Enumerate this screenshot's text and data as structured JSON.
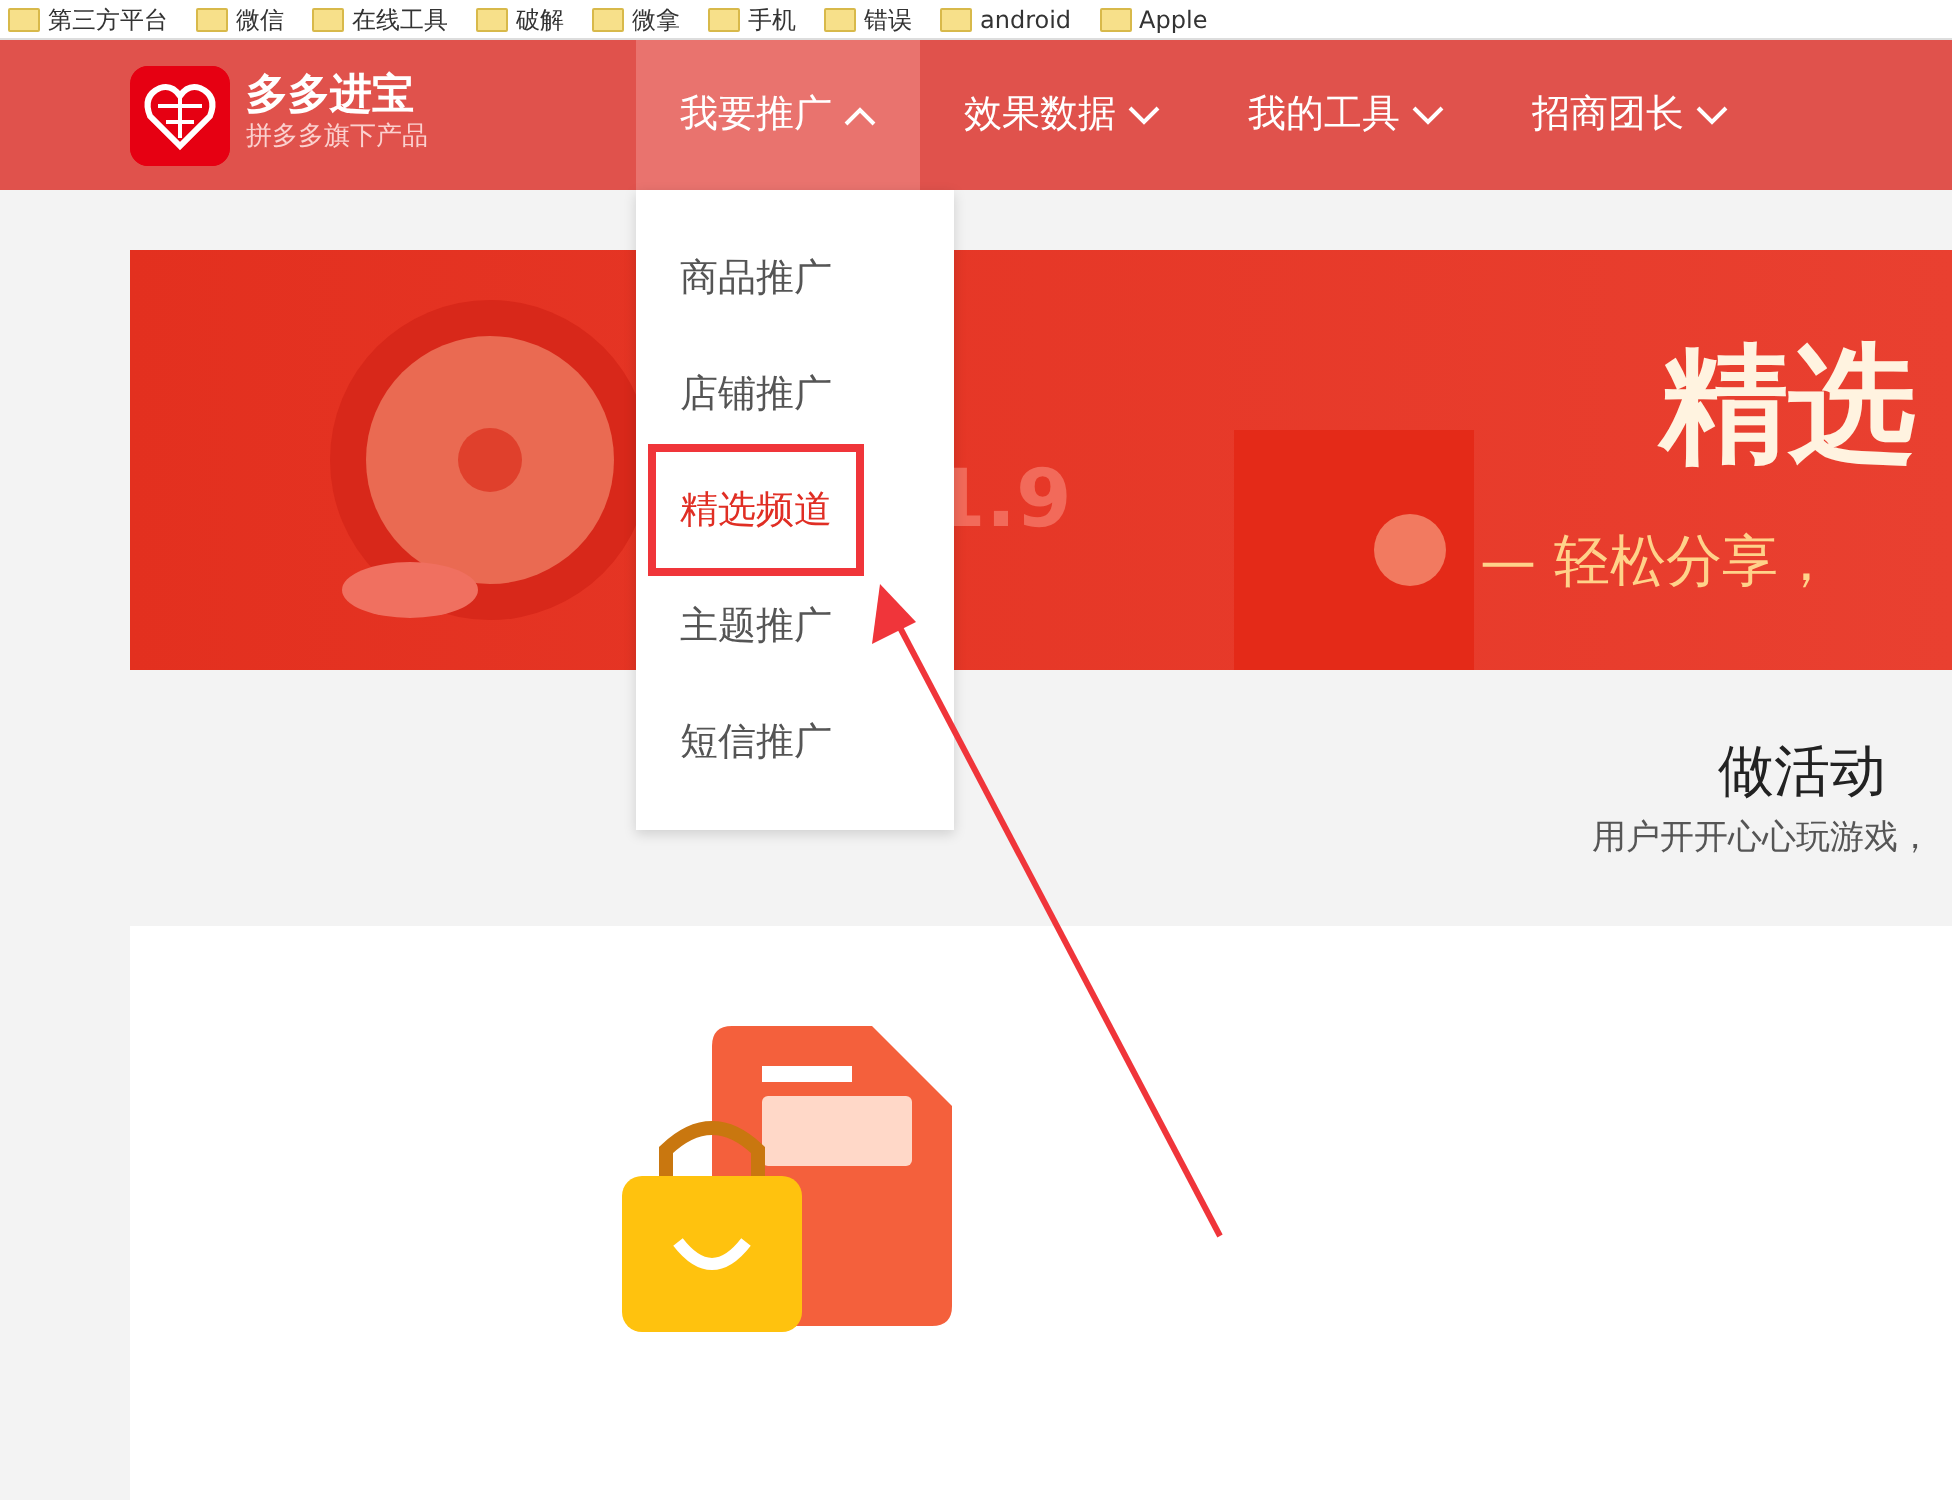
{
  "bookmarks": [
    "第三方平台",
    "微信",
    "在线工具",
    "破解",
    "微拿",
    "手机",
    "错误",
    "android",
    "Apple"
  ],
  "logo": {
    "title": "多多进宝",
    "subtitle": "拼多多旗下产品"
  },
  "nav": [
    {
      "label": "我要推广",
      "expanded": true
    },
    {
      "label": "效果数据",
      "expanded": false
    },
    {
      "label": "我的工具",
      "expanded": false
    },
    {
      "label": "招商团长",
      "expanded": false
    }
  ],
  "dropdown": [
    {
      "label": "商品推广",
      "selected": false
    },
    {
      "label": "店铺推广",
      "selected": false
    },
    {
      "label": "精选频道",
      "selected": true
    },
    {
      "label": "主题推广",
      "selected": false
    },
    {
      "label": "短信推广",
      "selected": false
    }
  ],
  "banner": {
    "title": "精选",
    "tagline": "— 轻松分享，",
    "price": "1.9"
  },
  "section": {
    "title": "做活动",
    "subtitle": "用户开开心心玩游戏，"
  }
}
